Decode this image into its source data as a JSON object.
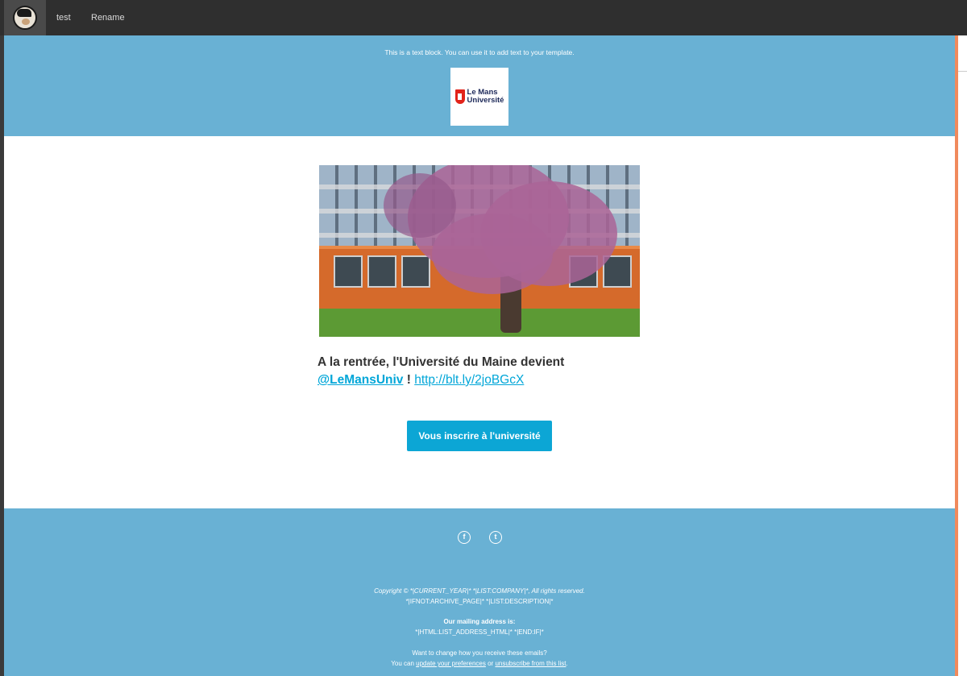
{
  "topbar": {
    "app_icon": "mailchimp-logo-icon",
    "link_test": "test",
    "link_rename": "Rename"
  },
  "header": {
    "text_block": "This is a text block. You can use it to add text to your template.",
    "brand_line1": "Le Mans",
    "brand_line2": "Université"
  },
  "content": {
    "headline_text": "A la rentrée, l'Université du Maine devient",
    "handle": "@LeMansUniv",
    "exclamation": " ! ",
    "short_url": "http://blt.ly/2joBGcX",
    "cta_label": "Vous inscrire à l'université"
  },
  "footer": {
    "facebook_glyph": "f",
    "twitter_glyph": "t",
    "copyright": "Copyright © *|CURRENT_YEAR|* *|LIST:COMPANY|*, All rights reserved.",
    "archive_line": "*|IFNOT:ARCHIVE_PAGE|* *|LIST:DESCRIPTION|*",
    "mailing_heading": "Our mailing address is:",
    "address_line": "*|HTML:LIST_ADDRESS_HTML|* *|END:IF|*",
    "change_line": "Want to change how you receive these emails?",
    "you_can": "You can ",
    "update_prefs": "update your preferences",
    "or_text": " or ",
    "unsubscribe": "unsubscribe from this list",
    "period": "."
  },
  "colors": {
    "band": "#69b1d4",
    "button": "#0ca6d5",
    "link": "#00a6d8",
    "accent_line": "#f08a5d"
  }
}
